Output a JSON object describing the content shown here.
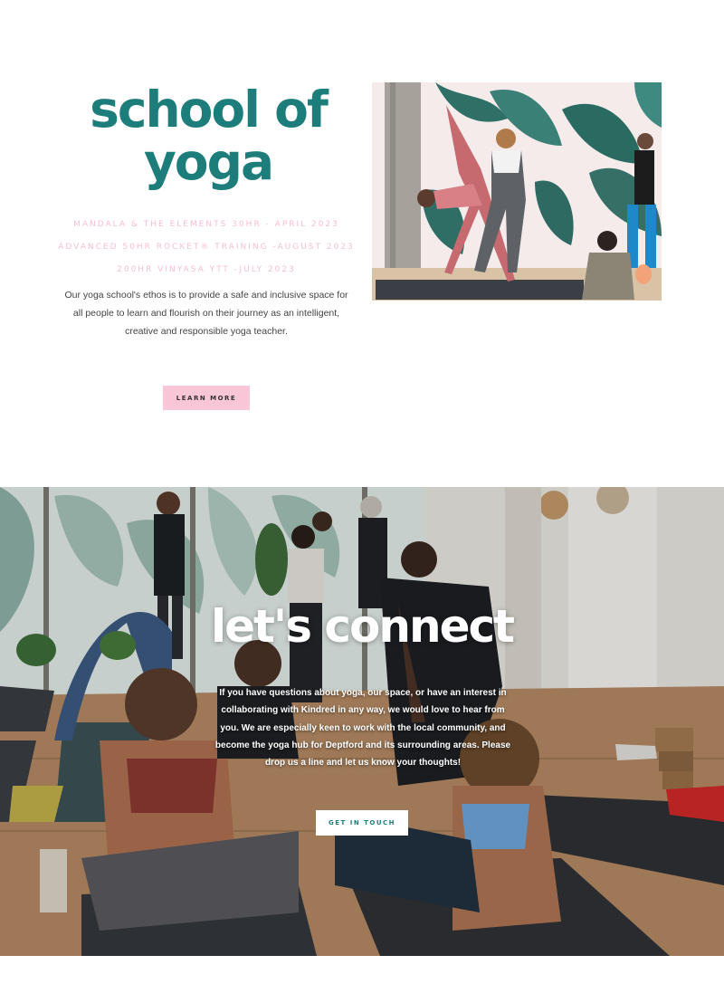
{
  "school": {
    "title_line1": "school of",
    "title_line2": "yoga",
    "courses": [
      "MANDALA & THE ELEMENTS 30HR - APRIL 2023",
      "ADVANCED 50HR ROCKET® TRAINING -AUGUST 2023",
      "200HR VINYASA YTT -JULY  2023"
    ],
    "ethos": "Our yoga school's ethos is to provide a safe and inclusive space for all people to learn and flourish on their journey as an intelligent, creative and responsible yoga teacher.",
    "cta_label": "LEARN MORE"
  },
  "connect": {
    "title": "let's connect",
    "body": "If you have questions about yoga, our space, or have an interest in collaborating with Kindred in any way, we would love to hear from you. We are especially keen to work with the local community, and become the yoga hub for Deptford and its surrounding areas. Please drop us a line and let us know your thoughts!",
    "cta_label": "GET IN TOUCH"
  },
  "colors": {
    "brand_teal": "#1d7d7a",
    "accent_pink": "#f8c6d6",
    "course_pink": "#f6bfcf"
  }
}
